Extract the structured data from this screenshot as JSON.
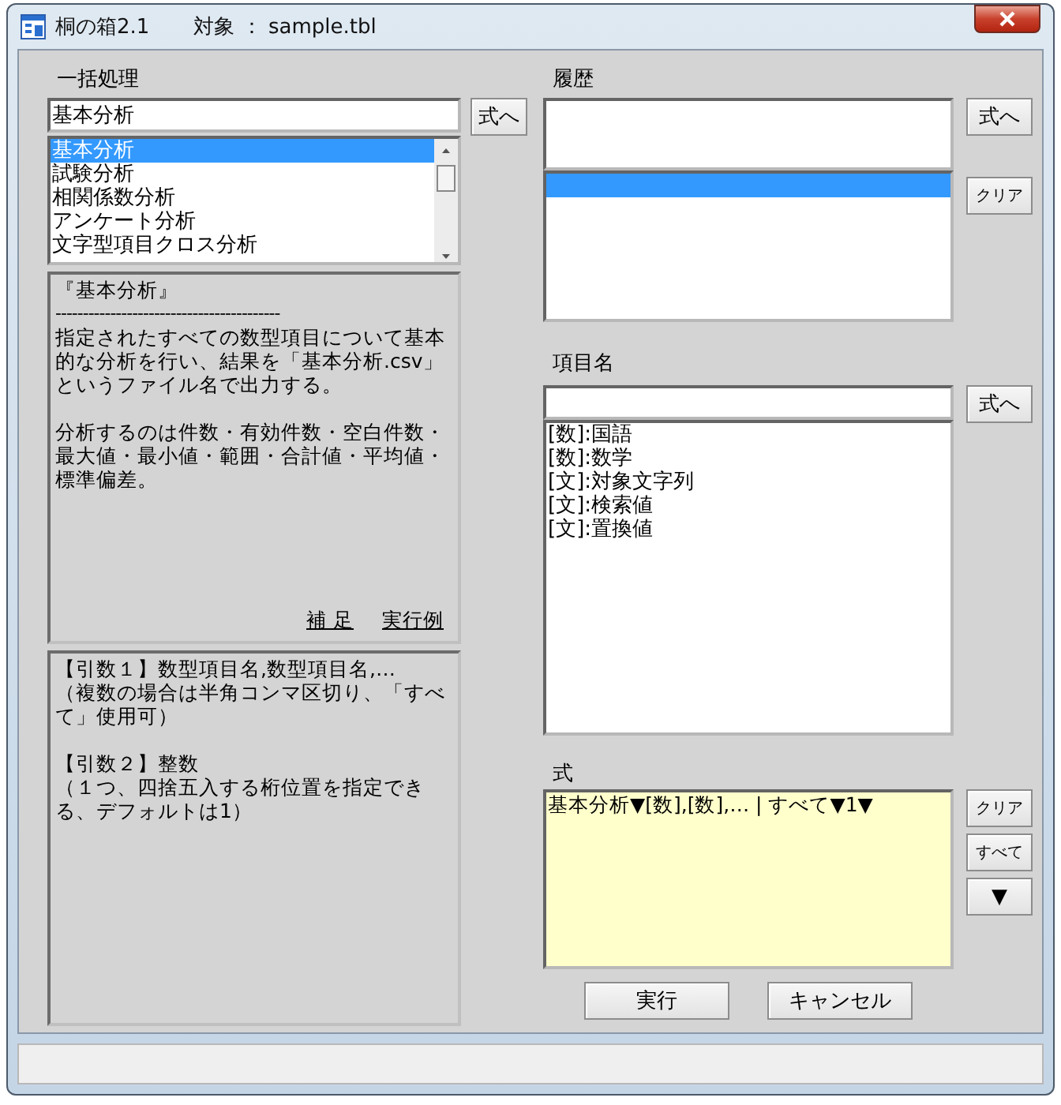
{
  "window": {
    "title": "桐の箱2.1",
    "target": "対象 ： sample.tbl"
  },
  "batch": {
    "label": "一括処理",
    "value": "基本分析",
    "to_formula": "式へ",
    "items": [
      {
        "label": "基本分析",
        "selected": true
      },
      {
        "label": "試験分析",
        "selected": false
      },
      {
        "label": "相関係数分析",
        "selected": false
      },
      {
        "label": "アンケート分析",
        "selected": false
      },
      {
        "label": "文字型項目クロス分析",
        "selected": false
      }
    ]
  },
  "description": {
    "title": "『基本分析』",
    "separator": "-----------------------------------------",
    "paragraphs": [
      "指定されたすべての数型項目について基本的な分析を行い、結果を「基本分析.csv」というファイル名で出力する。",
      "分析するのは件数・有効件数・空白件数・最大値・最小値・範囲・合計値・平均値・標準偏差。"
    ],
    "links": [
      "補 足",
      "実行例"
    ]
  },
  "arguments": [
    {
      "heading": "【引数１】数型項目名,数型項目名,…",
      "note": "（複数の場合は半角コンマ区切り、「すべて」使用可）"
    },
    {
      "heading": "【引数２】整数",
      "note": "（１つ、四捨五入する桁位置を指定できる、デフォルトは1）"
    }
  ],
  "history": {
    "label": "履歴",
    "to_formula": "式へ",
    "clear": "クリア",
    "items": [
      {
        "selected": true
      }
    ]
  },
  "fields": {
    "label": "項目名",
    "to_formula": "式へ",
    "items": [
      "[数]:国語",
      "[数]:数学",
      "[文]:対象文字列",
      "[文]:検索値",
      "[文]:置換値"
    ]
  },
  "formula": {
    "label": "式",
    "value": "基本分析▼[数],[数],… | すべて▼1▼",
    "clear": "クリア",
    "all": "すべて",
    "down": "▼"
  },
  "buttons": {
    "run": "実行",
    "cancel": "キャンセル"
  }
}
